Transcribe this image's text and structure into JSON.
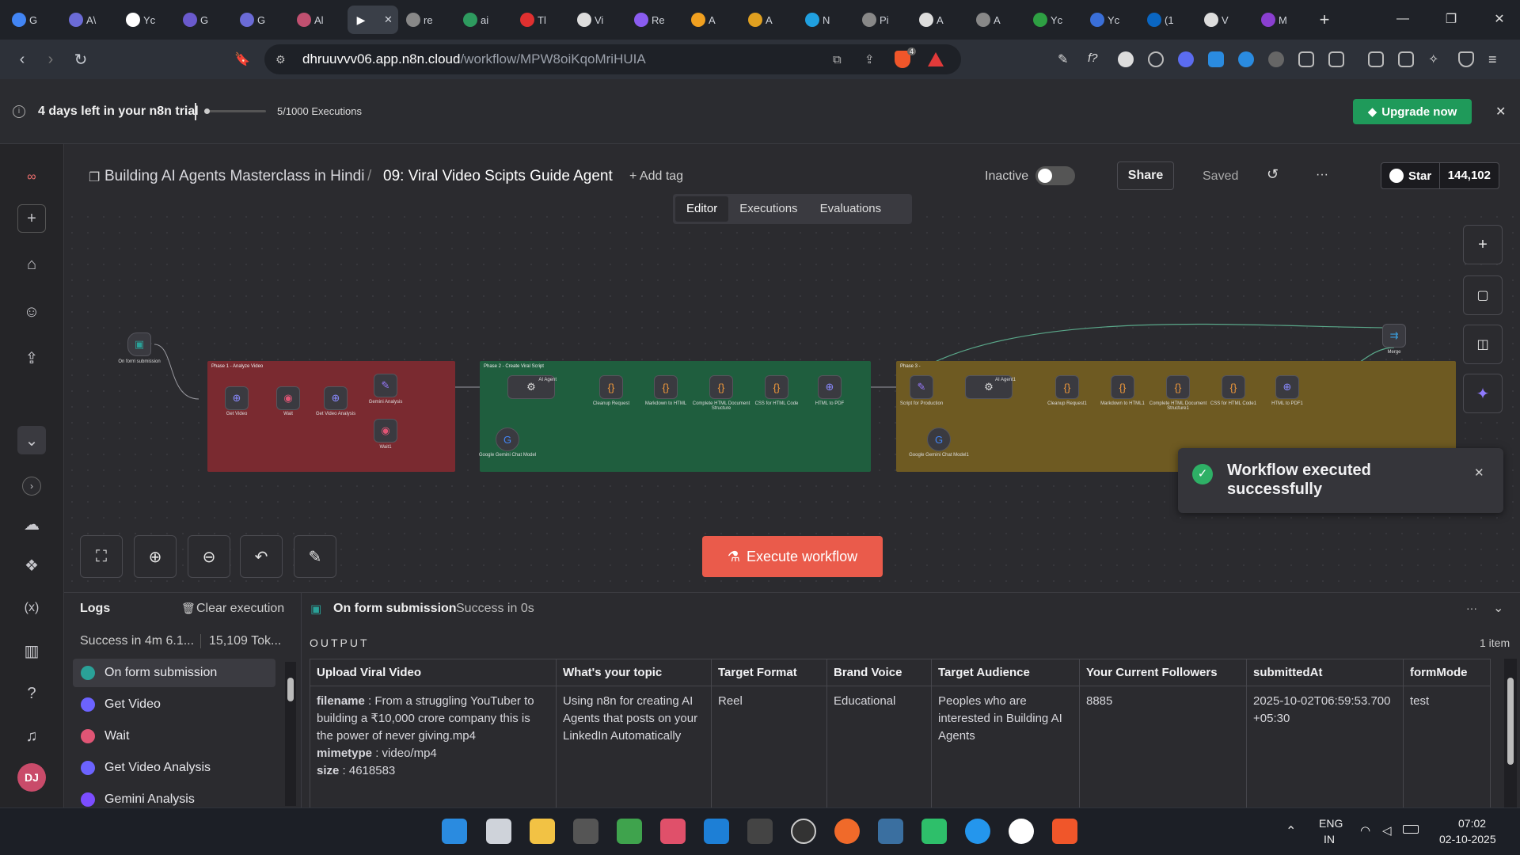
{
  "browser": {
    "tabs": [
      {
        "label": "G",
        "color": "#4285f4"
      },
      {
        "label": "A\\",
        "color": "#6b6bd6"
      },
      {
        "label": "Yc",
        "color": "#ffffff"
      },
      {
        "label": "G",
        "color": "#6a5acd"
      },
      {
        "label": "G",
        "color": "#6b6bd6"
      },
      {
        "label": "Al",
        "color": "#c05070"
      },
      {
        "label": "",
        "color": "#ffffff"
      },
      {
        "label": "re",
        "color": "#888888"
      },
      {
        "label": "ai",
        "color": "#2e9b5f"
      },
      {
        "label": "Tl",
        "color": "#e03030"
      },
      {
        "label": "Vi",
        "color": "#dddddd"
      },
      {
        "label": "Re",
        "color": "#8a5cf0"
      },
      {
        "label": "A",
        "color": "#f0a020"
      },
      {
        "label": "A",
        "color": "#e0a020"
      },
      {
        "label": "N",
        "color": "#20a0e0"
      },
      {
        "label": "Pi",
        "color": "#888888"
      },
      {
        "label": "A",
        "color": "#dddddd"
      },
      {
        "label": "A",
        "color": "#888888"
      },
      {
        "label": "Yc",
        "color": "#2ea043"
      },
      {
        "label": "Yc",
        "color": "#3a6fd8"
      },
      {
        "label": "(1",
        "color": "#0a66c2"
      },
      {
        "label": "V",
        "color": "#dddddd"
      },
      {
        "label": "M",
        "color": "#8a3fd0"
      }
    ],
    "new_tab": "+",
    "window_controls": {
      "minimize": "—",
      "maximize": "❐",
      "close": "✕"
    },
    "url_host": "dhruuvvv06.app.n8n.cloud",
    "url_path": "/workflow/MPW8oiKqoMriHUIA",
    "brave_badge": "4"
  },
  "trial": {
    "text": "4 days left in your n8n trial",
    "executions": "5/1000 Executions",
    "upgrade_label": "Upgrade now",
    "progress": 0.005
  },
  "header": {
    "project": "Building AI Agents Masterclass in Hindi",
    "separator": "/",
    "workflow_name": "09: Viral Video Scipts Guide Agent",
    "add_tag": "+ Add tag",
    "status_label": "Inactive",
    "share_label": "Share",
    "saved_label": "Saved",
    "more": "···",
    "star_label": "Star",
    "star_count": "144,102",
    "tabs": [
      "Editor",
      "Executions",
      "Evaluations"
    ]
  },
  "canvas": {
    "trigger_label": "On form submission",
    "groups": [
      {
        "title": "Phase 1 - Analyze Video",
        "color": "#7a2a30"
      },
      {
        "title": "Phase 2 - Create Viral Script",
        "color": "#1f5e3e"
      },
      {
        "title": "Phase 3 -",
        "color": "#6e5a22"
      }
    ],
    "nodes_p1": [
      "Get Video",
      "Wait",
      "Get Video Analysis",
      "Gemini Analysis",
      "Wait1"
    ],
    "nodes_p2": [
      "AI Agent",
      "Cleanup Request",
      "Markdown to HTML",
      "Complete HTML Document Structure",
      "CSS for HTML Code",
      "HTML to PDF",
      "Google Gemini Chat Model"
    ],
    "nodes_p3": [
      "Script for Production",
      "AI Agent1",
      "Cleanup Request1",
      "Markdown to HTML1",
      "Complete HTML Document Structure1",
      "CSS for HTML Code1",
      "HTML to PDF1",
      "Google Gemini Chat Model1"
    ],
    "merge_label": "Merge",
    "execute_label": "Execute workflow"
  },
  "toast": {
    "message": "Workflow executed successfully",
    "close": "✕"
  },
  "logs": {
    "title": "Logs",
    "clear_label": "Clear execution",
    "summary": "Success in 4m 6.1...",
    "tokens": "15,109 Tok...",
    "items": [
      {
        "label": "On form submission",
        "color": "#2aa198"
      },
      {
        "label": "Get Video",
        "color": "#6c63ff"
      },
      {
        "label": "Wait",
        "color": "#e05575"
      },
      {
        "label": "Get Video Analysis",
        "color": "#6c63ff"
      },
      {
        "label": "Gemini Analysis",
        "color": "#7c4dff"
      }
    ],
    "node_title": "On form submission",
    "node_status": "Success in 0s",
    "output_title": "OUTPUT",
    "item_count": "1 item",
    "columns": [
      "Upload Viral Video",
      "What's your topic",
      "Target Format",
      "Brand Voice",
      "Target Audience",
      "Your Current Followers",
      "submittedAt",
      "formMode"
    ],
    "file": {
      "filename_key": "filename",
      "filename_val": "From a struggling YouTuber to building a ₹10,000 crore company this is the power of never giving.mp4",
      "mimetype_key": "mimetype",
      "mimetype_val": "video/mp4",
      "size_key": "size",
      "size_val": "4618583"
    },
    "row": {
      "topic": "Using n8n for creating AI Agents that posts on your LinkedIn Automatically",
      "format": "Reel",
      "voice": "Educational",
      "audience": "Peoples who are interested in Building AI Agents",
      "followers": "8885",
      "submitted": "2025-10-02T06:59:53.700+05:30",
      "mode": "test"
    }
  },
  "taskbar": {
    "lang": "ENG",
    "region": "IN",
    "time": "07:02",
    "date": "02-10-2025"
  },
  "user": {
    "initials": "DJ"
  }
}
